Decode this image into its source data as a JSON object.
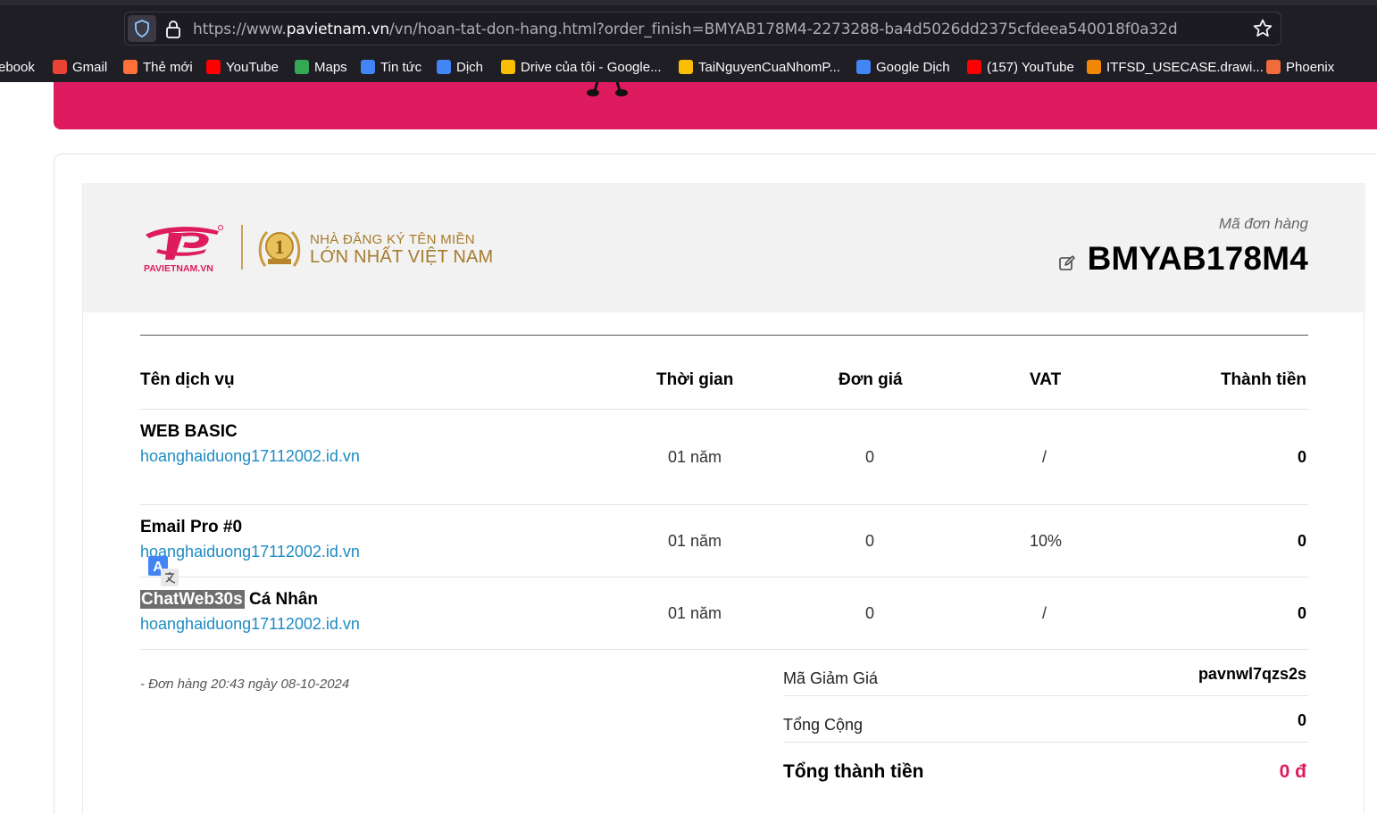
{
  "browser": {
    "url_prefix": "https://www.",
    "url_host": "pavietnam.vn",
    "url_rest": "/vn/hoan-tat-don-hang.html?order_finish=BMYAB178M4-2273288-ba4d5026dd2375cfdeea540018f0a32d",
    "bookmarks": [
      {
        "label": "ebook",
        "icon": "facebook-icon",
        "color": "#1877f2"
      },
      {
        "label": "Gmail",
        "icon": "gmail-icon",
        "color": "#ea4335"
      },
      {
        "label": "Thẻ mới",
        "icon": "firefox-icon",
        "color": "#ff7139"
      },
      {
        "label": "YouTube",
        "icon": "youtube-icon",
        "color": "#ff0000"
      },
      {
        "label": "Maps",
        "icon": "maps-icon",
        "color": "#34a853"
      },
      {
        "label": "Tin tức",
        "icon": "news-icon",
        "color": "#4285f4"
      },
      {
        "label": "Dịch",
        "icon": "translate-icon",
        "color": "#4285f4"
      },
      {
        "label": "Drive của tôi - Google...",
        "icon": "drive-icon",
        "color": "#fbbc04"
      },
      {
        "label": "TaiNguyenCuaNhomP...",
        "icon": "drive-icon",
        "color": "#fbbc04"
      },
      {
        "label": "Google Dịch",
        "icon": "translate-icon",
        "color": "#4285f4"
      },
      {
        "label": "(157) YouTube",
        "icon": "youtube-icon",
        "color": "#ff0000"
      },
      {
        "label": "ITFSD_USECASE.drawi...",
        "icon": "drawio-icon",
        "color": "#f08705"
      },
      {
        "label": "Phoenix",
        "icon": "phoenix-icon",
        "color": "#f26b3a"
      }
    ]
  },
  "header": {
    "logo_text": "PAVIETNAM.VN",
    "medal_number": "1",
    "slogan_line1": "NHÀ ĐĂNG KÝ TÊN MIỀN",
    "slogan_line2": "LỚN NHẤT VIỆT NAM",
    "order_label": "Mã đơn hàng",
    "order_code": "BMYAB178M4"
  },
  "table": {
    "columns": [
      "Tên dịch vụ",
      "Thời gian",
      "Đơn giá",
      "VAT",
      "Thành tiền"
    ],
    "rows": [
      {
        "name": "WEB BASIC",
        "name_suffix": "",
        "domain": "hoanghaiduong17112002.id.vn",
        "time": "01 năm",
        "price": "0",
        "vat": "/",
        "total": "0"
      },
      {
        "name": "Email Pro #0",
        "name_suffix": "",
        "domain": "hoanghaiduong17112002.id.vn",
        "time": "01 năm",
        "price": "0",
        "vat": "10%",
        "total": "0"
      },
      {
        "name": "ChatWeb30s",
        "name_suffix": " Cá Nhân",
        "domain": "hoanghaiduong17112002.id.vn",
        "time": "01 năm",
        "price": "0",
        "vat": "/",
        "total": "0"
      }
    ]
  },
  "summary": {
    "order_note": "- Đơn hàng 20:43 ngày 08-10-2024",
    "discount_label": "Mã Giảm Giá",
    "discount_value": "pavnwl7qzs2s",
    "subtotal_label": "Tổng Cộng",
    "subtotal_value": "0",
    "total_label": "Tổng thành tiền",
    "total_value": "0 đ"
  },
  "colors": {
    "brand": "#de1b5e",
    "link": "#1e8bc3",
    "gold": "#a87b2c"
  }
}
